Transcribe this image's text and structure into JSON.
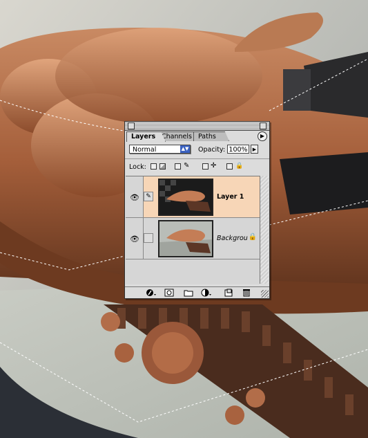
{
  "panel": {
    "tabs": [
      {
        "label": "Layers",
        "active": true
      },
      {
        "label": "Channels",
        "active": false
      },
      {
        "label": "Paths",
        "active": false
      }
    ],
    "menu_glyph": "▶",
    "blend_mode": "Normal",
    "opacity_label": "Opacity:",
    "opacity_value": "100%",
    "lock_label": "Lock:",
    "layers": [
      {
        "name": "Layer 1",
        "visible": true,
        "selected": true,
        "locked": false
      },
      {
        "name": "Backgrou",
        "visible": true,
        "selected": false,
        "locked": true
      }
    ]
  },
  "glyphs": {
    "eye": "👁",
    "brush": "✎",
    "lock": "🔒",
    "move": "✛",
    "dropdown": "▲▼",
    "opacity_arrow": "▶"
  },
  "colors": {
    "selected_row": "#f7d6b7",
    "select_arrow": "#3a61c0",
    "copper": "#b06a44"
  }
}
